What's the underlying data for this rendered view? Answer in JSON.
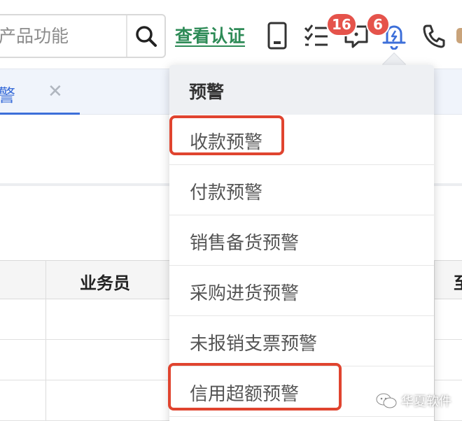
{
  "header": {
    "search": {
      "placeholder": "产品功能",
      "value": ""
    },
    "verify_link": "查看认证",
    "icons": [
      "search-icon",
      "tablet-icon",
      "checklist-icon",
      "message-icon",
      "bell-icon",
      "phone-icon"
    ],
    "task_badge": "16",
    "alert_badge": "6"
  },
  "tabs": [
    {
      "label": "预警",
      "active": true
    }
  ],
  "table": {
    "columns": [
      "业务员",
      "至"
    ]
  },
  "alert_menu": {
    "title": "预警",
    "items": [
      {
        "label": "收款预警",
        "highlighted": true
      },
      {
        "label": "付款预警",
        "highlighted": false
      },
      {
        "label": "销售备货预警",
        "highlighted": false
      },
      {
        "label": "采购进货预警",
        "highlighted": false
      },
      {
        "label": "未报销支票预警",
        "highlighted": false
      },
      {
        "label": "信用超额预警",
        "highlighted": true
      }
    ]
  },
  "colors": {
    "accent": "#3d6fd9",
    "link": "#2e8b57",
    "badge": "#e5534b",
    "highlight": "#e0442f"
  },
  "watermark": "华夏软件"
}
